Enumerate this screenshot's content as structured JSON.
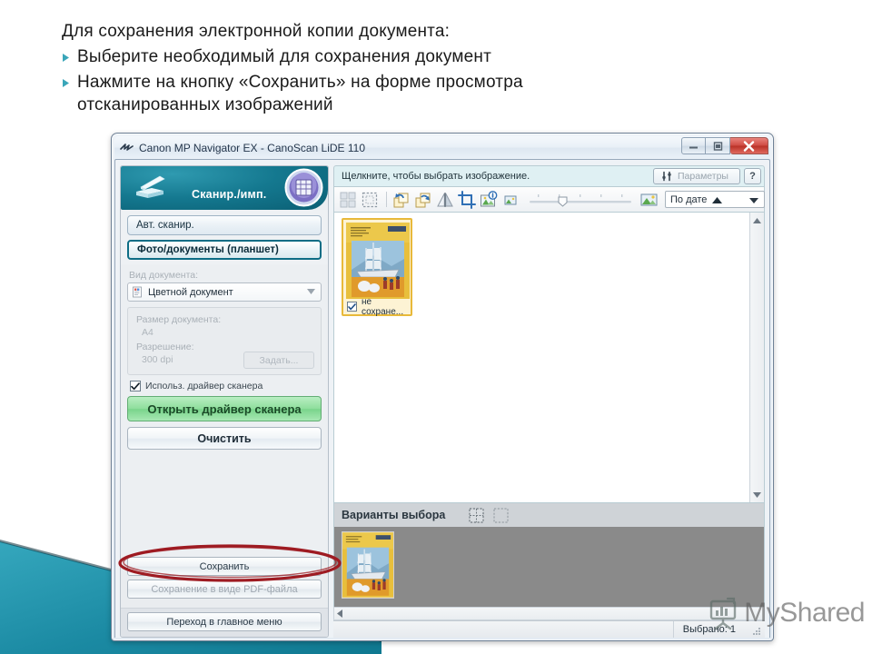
{
  "slide": {
    "lead": "Для сохранения электронной копии документа:",
    "bullets": [
      "Выберите необходимый для сохранения документ",
      "Нажмите на кнопку «Сохранить» на форме просмотра отсканированных изображений"
    ],
    "ghost_text": "…охранить» на форме просмотра",
    "accent_color": "#3aa6b9",
    "banner_color": "#1b8aa3",
    "annotation_color": "#9e1b22"
  },
  "window": {
    "title": "Canon MP Navigator EX - CanoScan LiDE 110",
    "app_icon": "canon-logo-icon",
    "controls": {
      "minimize": "minimize-icon",
      "maximize": "maximize-icon",
      "close": "close-icon"
    }
  },
  "left_panel": {
    "mode_title": "Сканир./имп.",
    "scanner_icon": "flatbed-scanner-icon",
    "album_icon": "album-grid-icon",
    "mode_buttons": [
      {
        "label": "Авт. сканир.",
        "active": false
      },
      {
        "label": "Фото/документы (планшет)",
        "active": true
      }
    ],
    "doc_type": {
      "label": "Вид документа:",
      "value": "Цветной документ",
      "icon": "color-document-icon",
      "caret": "chevron-down-icon"
    },
    "doc_size": {
      "label": "Размер документа:",
      "value": "A4"
    },
    "resolution": {
      "label": "Разрешение:",
      "value": "300 dpi"
    },
    "setup_button": "Задать...",
    "driver_checkbox": {
      "label": "Использ. драйвер сканера",
      "checked": true
    },
    "open_driver_button": "Открыть драйвер сканера",
    "clear_button": "Очистить",
    "save_button": "Сохранить",
    "save_pdf_button": "Сохранение в виде PDF-файла",
    "main_menu_button": "Переход в главное меню"
  },
  "right_panel": {
    "hint": "Щелкните, чтобы выбрать изображение.",
    "params_button": "Параметры",
    "params_icon": "settings-sliders-icon",
    "help_button": "?",
    "toolbar_icons": [
      "select-all-icon",
      "deselect-all-icon",
      "rotate-left-icon",
      "rotate-right-icon",
      "flip-horizontal-icon",
      "crop-icon",
      "image-info-icon"
    ],
    "zoom": {
      "small_icon": "small-thumbnail-icon",
      "large_icon": "large-thumbnail-icon",
      "value": 35
    },
    "sort": {
      "label": "По дате",
      "direction_icon": "sort-ascending-icon",
      "caret": "chevron-down-icon"
    },
    "thumbnails": [
      {
        "caption": "не сохране...",
        "checked": true,
        "selected": true
      }
    ],
    "scroll": {
      "up_icon": "scroll-up-icon",
      "down_icon": "scroll-down-icon",
      "left_icon": "scroll-left-icon"
    },
    "variants": {
      "title": "Варианты выбора",
      "select_all_icon": "select-all-icon",
      "deselect_all_icon": "deselect-all-icon",
      "items": [
        {
          "name": "variant-thumbnail-1"
        }
      ]
    },
    "status": {
      "selected_text": "Выбрано: 1"
    }
  },
  "watermark": {
    "text": "MyShared",
    "logo": "myshared-easel-icon"
  }
}
